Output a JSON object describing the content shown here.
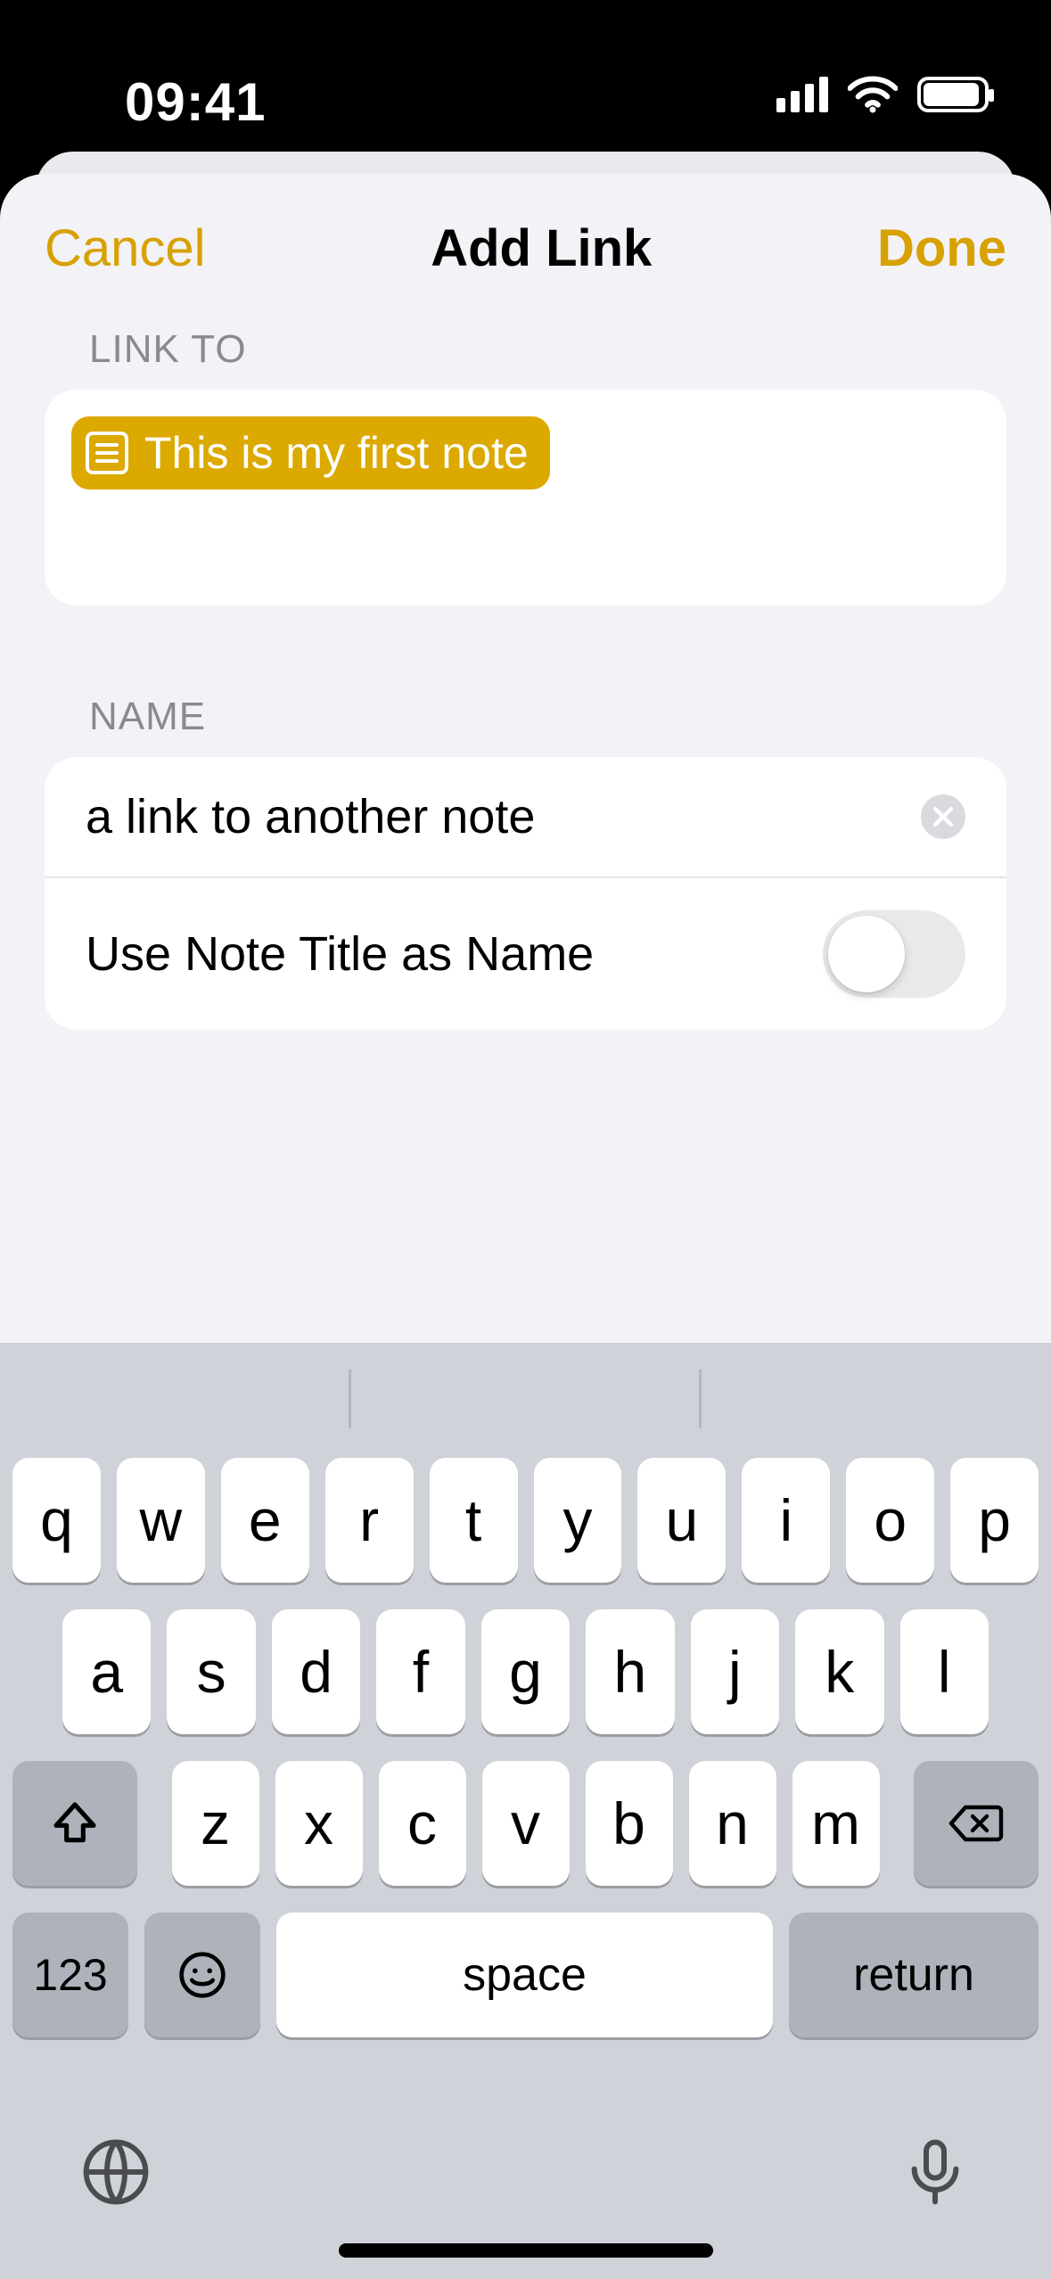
{
  "status": {
    "time": "09:41"
  },
  "nav": {
    "cancel": "Cancel",
    "title": "Add Link",
    "done": "Done"
  },
  "sections": {
    "linkto_label": "LINK TO",
    "name_label": "NAME"
  },
  "link_target": {
    "chip_text": "This is my first note"
  },
  "name_field": {
    "value": "a link to another note"
  },
  "use_title_row": {
    "label": "Use Note Title as Name",
    "on": false
  },
  "keyboard": {
    "row1": [
      "q",
      "w",
      "e",
      "r",
      "t",
      "y",
      "u",
      "i",
      "o",
      "p"
    ],
    "row2": [
      "a",
      "s",
      "d",
      "f",
      "g",
      "h",
      "j",
      "k",
      "l"
    ],
    "row3": [
      "z",
      "x",
      "c",
      "v",
      "b",
      "n",
      "m"
    ],
    "numKey": "123",
    "space": "space",
    "return": "return"
  },
  "colors": {
    "accent": "#d7a100",
    "chip": "#dca900"
  }
}
